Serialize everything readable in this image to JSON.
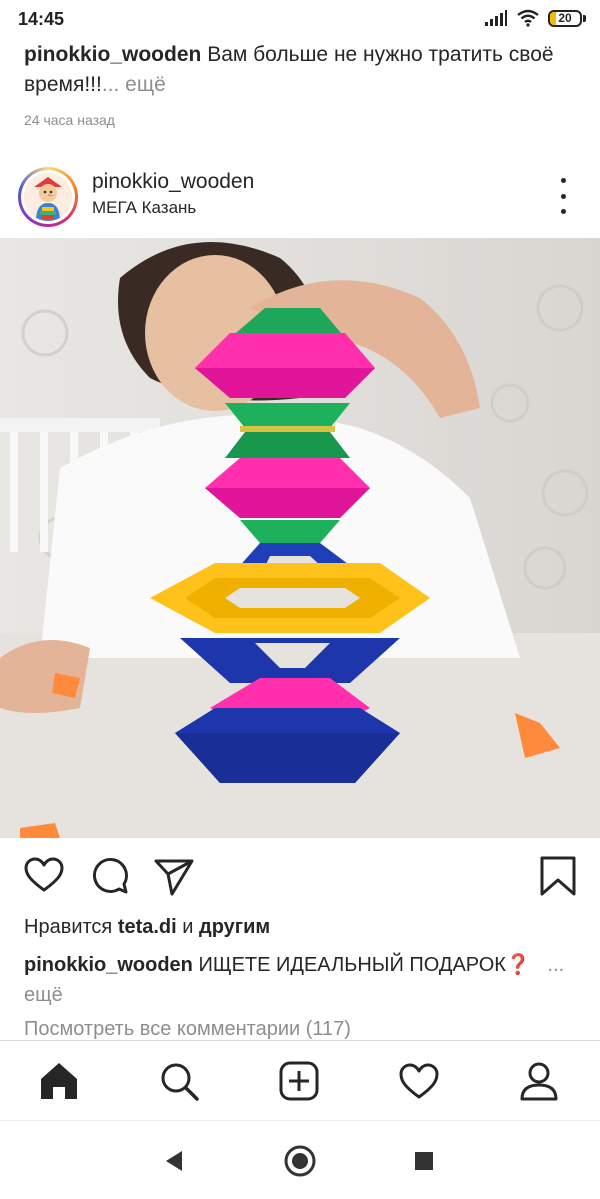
{
  "status": {
    "time": "14:45",
    "battery": "20",
    "battery_level": 0.2
  },
  "previous_post": {
    "username": "pinokkio_wooden",
    "caption": "Вам больше не нужно тратить своё время!!!",
    "more": "... ещё",
    "time": "24 часа назад"
  },
  "post": {
    "username": "pinokkio_wooden",
    "location": "МЕГА Казань",
    "likes": {
      "prefix": "Нравится ",
      "user": "teta.di",
      "middle": " и ",
      "others": "другим"
    },
    "caption": {
      "username": "pinokkio_wooden",
      "text": "ИЩЕТЕ ИДЕАЛЬНЫЙ ПОДАРОК❓",
      "more": "... ещё"
    },
    "view_comments": "Посмотреть все комментарии (117)"
  },
  "icons": {
    "more": "more-vertical-icon",
    "like": "heart-icon",
    "comment": "comment-icon",
    "share": "send-icon",
    "save": "bookmark-icon",
    "nav": [
      "home-icon",
      "search-icon",
      "add-post-icon",
      "activity-heart-icon",
      "profile-icon"
    ],
    "system": [
      "back-icon",
      "home-circle-icon",
      "recents-icon"
    ]
  },
  "colors": {
    "text": "#262626",
    "muted": "#8e8e8e",
    "battery": "#f0c000"
  }
}
